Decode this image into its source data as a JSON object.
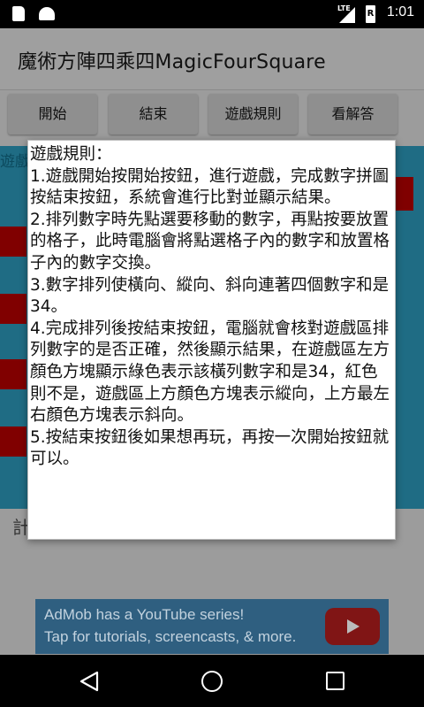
{
  "status_bar": {
    "network": "LTE",
    "battery_level": "R",
    "time": "1:01",
    "icons": [
      "sd-card-icon",
      "android-icon",
      "signal-icon",
      "battery-icon"
    ]
  },
  "app_bar": {
    "title": "魔術方陣四乘四MagicFourSquare"
  },
  "toolbar": {
    "start_label": "開始",
    "end_label": "結束",
    "rules_label": "遊戲規則",
    "answer_label": "看解答"
  },
  "game": {
    "area_label": "遊戲"
  },
  "bottom_hint": "計",
  "dialog": {
    "lines": [
      "遊戲規則：",
      "1.遊戲開始按開始按鈕，進行遊戲，完成數字拼圖按結束按鈕，系統會進行比對並顯示結果。",
      "2.排列數字時先點選要移動的數字，再點按要放置的格子，此時電腦會將點選格子內的數字和放置格子內的數字交換。",
      "3.數字排列使橫向、縱向、斜向連著四個數字和是34。",
      "4.完成排列後按結束按鈕，電腦就會核對遊戲區排列數字的是否正確，然後顯示結果，在遊戲區左方顏色方塊顯示綠色表示該橫列數字和是34，紅色則不是，遊戲區上方顏色方塊表示縱向，上方最左右顏色方塊表示斜向。",
      "5.按結束按鈕後如果想再玩，再按一次開始按鈕就可以。"
    ]
  },
  "ad": {
    "line1": "AdMob has a YouTube series!",
    "line2": "Tap for tutorials, screencasts, & more."
  },
  "nav_bar": {
    "icons": [
      "back-icon",
      "home-icon",
      "recents-icon"
    ]
  },
  "colors": {
    "game_area": "#1f6c84",
    "indicator_red": "#800000",
    "ad_background": "#2f5f80"
  }
}
